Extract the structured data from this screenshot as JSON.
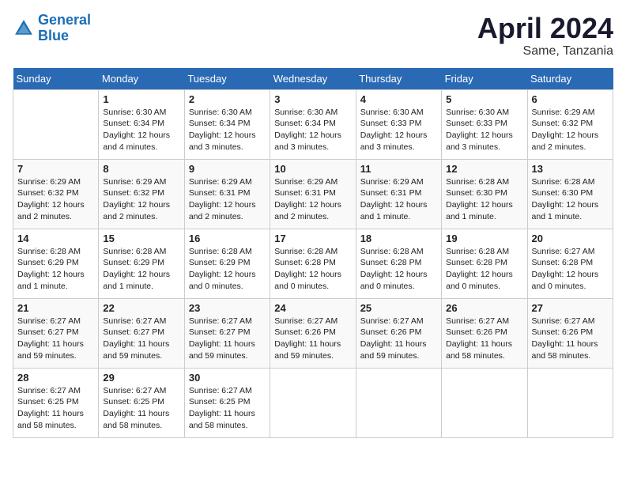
{
  "header": {
    "logo_line1": "General",
    "logo_line2": "Blue",
    "month": "April 2024",
    "location": "Same, Tanzania"
  },
  "days_of_week": [
    "Sunday",
    "Monday",
    "Tuesday",
    "Wednesday",
    "Thursday",
    "Friday",
    "Saturday"
  ],
  "weeks": [
    [
      {
        "day": "",
        "info": ""
      },
      {
        "day": "1",
        "info": "Sunrise: 6:30 AM\nSunset: 6:34 PM\nDaylight: 12 hours\nand 4 minutes."
      },
      {
        "day": "2",
        "info": "Sunrise: 6:30 AM\nSunset: 6:34 PM\nDaylight: 12 hours\nand 3 minutes."
      },
      {
        "day": "3",
        "info": "Sunrise: 6:30 AM\nSunset: 6:34 PM\nDaylight: 12 hours\nand 3 minutes."
      },
      {
        "day": "4",
        "info": "Sunrise: 6:30 AM\nSunset: 6:33 PM\nDaylight: 12 hours\nand 3 minutes."
      },
      {
        "day": "5",
        "info": "Sunrise: 6:30 AM\nSunset: 6:33 PM\nDaylight: 12 hours\nand 3 minutes."
      },
      {
        "day": "6",
        "info": "Sunrise: 6:29 AM\nSunset: 6:32 PM\nDaylight: 12 hours\nand 2 minutes."
      }
    ],
    [
      {
        "day": "7",
        "info": "Sunrise: 6:29 AM\nSunset: 6:32 PM\nDaylight: 12 hours\nand 2 minutes."
      },
      {
        "day": "8",
        "info": "Sunrise: 6:29 AM\nSunset: 6:32 PM\nDaylight: 12 hours\nand 2 minutes."
      },
      {
        "day": "9",
        "info": "Sunrise: 6:29 AM\nSunset: 6:31 PM\nDaylight: 12 hours\nand 2 minutes."
      },
      {
        "day": "10",
        "info": "Sunrise: 6:29 AM\nSunset: 6:31 PM\nDaylight: 12 hours\nand 2 minutes."
      },
      {
        "day": "11",
        "info": "Sunrise: 6:29 AM\nSunset: 6:31 PM\nDaylight: 12 hours\nand 1 minute."
      },
      {
        "day": "12",
        "info": "Sunrise: 6:28 AM\nSunset: 6:30 PM\nDaylight: 12 hours\nand 1 minute."
      },
      {
        "day": "13",
        "info": "Sunrise: 6:28 AM\nSunset: 6:30 PM\nDaylight: 12 hours\nand 1 minute."
      }
    ],
    [
      {
        "day": "14",
        "info": "Sunrise: 6:28 AM\nSunset: 6:29 PM\nDaylight: 12 hours\nand 1 minute."
      },
      {
        "day": "15",
        "info": "Sunrise: 6:28 AM\nSunset: 6:29 PM\nDaylight: 12 hours\nand 1 minute."
      },
      {
        "day": "16",
        "info": "Sunrise: 6:28 AM\nSunset: 6:29 PM\nDaylight: 12 hours\nand 0 minutes."
      },
      {
        "day": "17",
        "info": "Sunrise: 6:28 AM\nSunset: 6:28 PM\nDaylight: 12 hours\nand 0 minutes."
      },
      {
        "day": "18",
        "info": "Sunrise: 6:28 AM\nSunset: 6:28 PM\nDaylight: 12 hours\nand 0 minutes."
      },
      {
        "day": "19",
        "info": "Sunrise: 6:28 AM\nSunset: 6:28 PM\nDaylight: 12 hours\nand 0 minutes."
      },
      {
        "day": "20",
        "info": "Sunrise: 6:27 AM\nSunset: 6:28 PM\nDaylight: 12 hours\nand 0 minutes."
      }
    ],
    [
      {
        "day": "21",
        "info": "Sunrise: 6:27 AM\nSunset: 6:27 PM\nDaylight: 11 hours\nand 59 minutes."
      },
      {
        "day": "22",
        "info": "Sunrise: 6:27 AM\nSunset: 6:27 PM\nDaylight: 11 hours\nand 59 minutes."
      },
      {
        "day": "23",
        "info": "Sunrise: 6:27 AM\nSunset: 6:27 PM\nDaylight: 11 hours\nand 59 minutes."
      },
      {
        "day": "24",
        "info": "Sunrise: 6:27 AM\nSunset: 6:26 PM\nDaylight: 11 hours\nand 59 minutes."
      },
      {
        "day": "25",
        "info": "Sunrise: 6:27 AM\nSunset: 6:26 PM\nDaylight: 11 hours\nand 59 minutes."
      },
      {
        "day": "26",
        "info": "Sunrise: 6:27 AM\nSunset: 6:26 PM\nDaylight: 11 hours\nand 58 minutes."
      },
      {
        "day": "27",
        "info": "Sunrise: 6:27 AM\nSunset: 6:26 PM\nDaylight: 11 hours\nand 58 minutes."
      }
    ],
    [
      {
        "day": "28",
        "info": "Sunrise: 6:27 AM\nSunset: 6:25 PM\nDaylight: 11 hours\nand 58 minutes."
      },
      {
        "day": "29",
        "info": "Sunrise: 6:27 AM\nSunset: 6:25 PM\nDaylight: 11 hours\nand 58 minutes."
      },
      {
        "day": "30",
        "info": "Sunrise: 6:27 AM\nSunset: 6:25 PM\nDaylight: 11 hours\nand 58 minutes."
      },
      {
        "day": "",
        "info": ""
      },
      {
        "day": "",
        "info": ""
      },
      {
        "day": "",
        "info": ""
      },
      {
        "day": "",
        "info": ""
      }
    ]
  ]
}
